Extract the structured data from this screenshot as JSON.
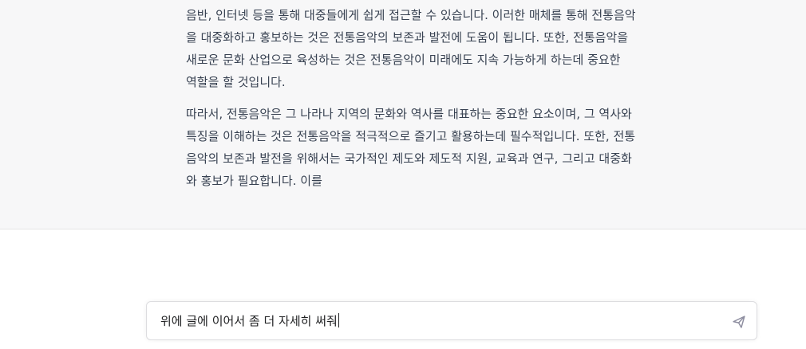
{
  "response": {
    "paragraphs": [
      {
        "lines": [
          "음반, 인터넷 등을 통해 대중들에게 쉽게 접근할 수 있습니다. 이러한 매체를 통해 전통음악",
          "을 대중화하고 홍보하는 것은 전통음악의 보존과 발전에 도움이 됩니다. 또한, 전통음악을",
          "새로운 문화 산업으로 육성하는 것은 전통음악이 미래에도 지속 가능하게 하는데 중요한",
          "역할을 할 것입니다."
        ]
      },
      {
        "lines": [
          "따라서, 전통음악은 그 나라나 지역의 문화와 역사를 대표하는 중요한 요소이며, 그 역사와",
          "특징을 이해하는 것은 전통음악을 적극적으로 즐기고 활용하는데 필수적입니다. 또한, 전통",
          "음악의 보존과 발전을 위해서는 국가적인 제도와 제도적 지원, 교육과 연구, 그리고 대중화",
          "와 홍보가 필요합니다. 이를"
        ]
      }
    ]
  },
  "composer": {
    "input_value": "위에 글에 이어서 좀 더 자세히 써줘",
    "send_icon": "paper-plane-icon"
  },
  "colors": {
    "response_background": "#f7f7f8",
    "text": "#374151",
    "icon": "#8e8ea0"
  }
}
